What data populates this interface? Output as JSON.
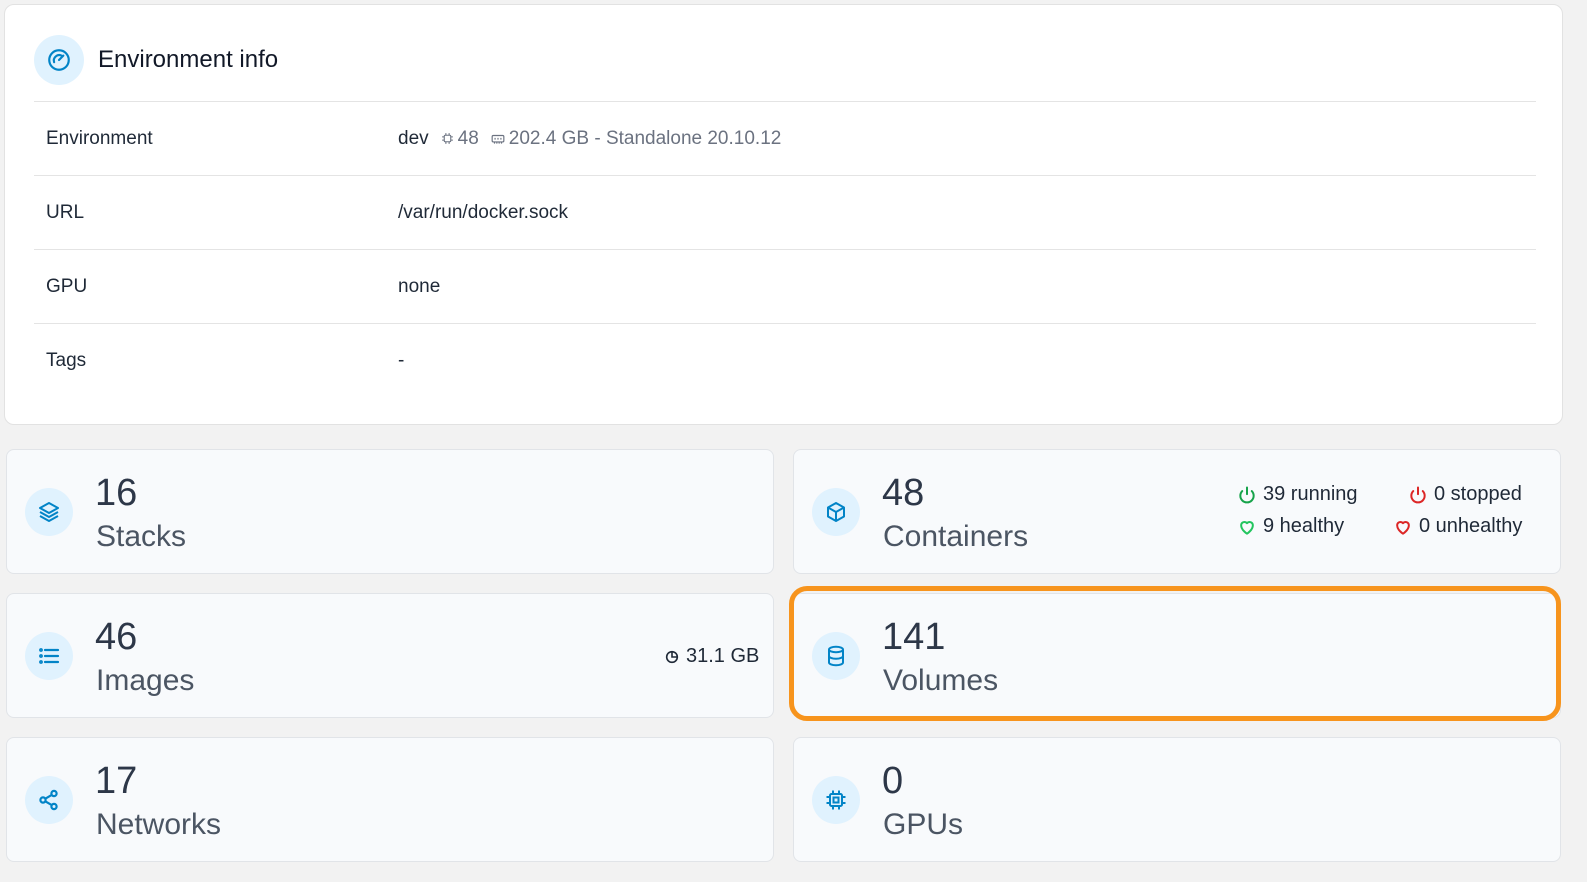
{
  "env_info": {
    "title": "Environment info",
    "title_icon": "speedometer-icon",
    "rows": {
      "environment": {
        "label": "Environment",
        "name": "dev",
        "cpu": "48",
        "memory": "202.4 GB - Standalone 20.10.12"
      },
      "url": {
        "label": "URL",
        "value": "/var/run/docker.sock"
      },
      "gpu": {
        "label": "GPU",
        "value": "none"
      },
      "tags": {
        "label": "Tags",
        "value": "-"
      }
    }
  },
  "cards": {
    "stacks": {
      "count": "16",
      "label": "Stacks",
      "icon": "layers-icon"
    },
    "containers": {
      "count": "48",
      "label": "Containers",
      "icon": "box-icon",
      "running": "39 running",
      "stopped": "0 stopped",
      "healthy": "9 healthy",
      "unhealthy": "0 unhealthy"
    },
    "images": {
      "count": "46",
      "label": "Images",
      "icon": "list-icon",
      "size": "31.1 GB"
    },
    "volumes": {
      "count": "141",
      "label": "Volumes",
      "icon": "database-icon",
      "highlighted": true
    },
    "networks": {
      "count": "17",
      "label": "Networks",
      "icon": "share-icon"
    },
    "gpus": {
      "count": "0",
      "label": "GPUs",
      "icon": "chip-icon"
    }
  },
  "colors": {
    "accent": "#0284c7",
    "running": "#16a34a",
    "stopped": "#dc2626",
    "healthy": "#22c55e",
    "unhealthy": "#dc2626",
    "highlight": "#f7941d"
  }
}
